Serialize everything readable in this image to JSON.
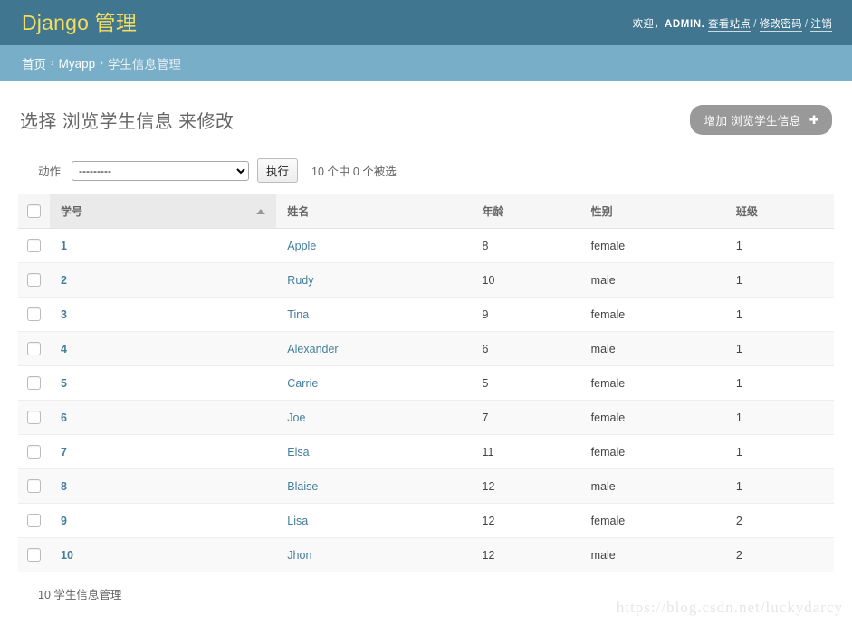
{
  "header": {
    "site_title": "Django 管理",
    "welcome_prefix": "欢迎，",
    "username": "ADMIN.",
    "links": [
      {
        "label": "查看站点"
      },
      {
        "label": "修改密码"
      },
      {
        "label": "注销"
      }
    ],
    "separator": "/"
  },
  "breadcrumbs": {
    "items": [
      {
        "label": "首页"
      },
      {
        "label": "Myapp"
      },
      {
        "label": "学生信息管理"
      }
    ],
    "separator": "›"
  },
  "main": {
    "page_title": "选择 浏览学生信息 来修改",
    "add_button_label": "增加 浏览学生信息",
    "add_button_icon": "plus-icon",
    "plus_glyph": "✚"
  },
  "actions": {
    "label": "动作",
    "selected_option": "---------",
    "options": [
      "---------"
    ],
    "go_label": "执行",
    "counter": "10 个中 0 个被选"
  },
  "table": {
    "columns": [
      {
        "key": "id",
        "label": "学号",
        "sorted": true,
        "sort_direction": "asc"
      },
      {
        "key": "name",
        "label": "姓名",
        "sorted": false
      },
      {
        "key": "age",
        "label": "年龄",
        "sorted": false
      },
      {
        "key": "gender",
        "label": "性别",
        "sorted": false
      },
      {
        "key": "grade",
        "label": "班级",
        "sorted": false
      }
    ],
    "rows": [
      {
        "id": "1",
        "name": "Apple",
        "age": "8",
        "gender": "female",
        "grade": "1"
      },
      {
        "id": "2",
        "name": "Rudy",
        "age": "10",
        "gender": "male",
        "grade": "1"
      },
      {
        "id": "3",
        "name": "Tina",
        "age": "9",
        "gender": "female",
        "grade": "1"
      },
      {
        "id": "4",
        "name": "Alexander",
        "age": "6",
        "gender": "male",
        "grade": "1"
      },
      {
        "id": "5",
        "name": "Carrie",
        "age": "5",
        "gender": "female",
        "grade": "1"
      },
      {
        "id": "6",
        "name": "Joe",
        "age": "7",
        "gender": "female",
        "grade": "1"
      },
      {
        "id": "7",
        "name": "Elsa",
        "age": "11",
        "gender": "female",
        "grade": "1"
      },
      {
        "id": "8",
        "name": "Blaise",
        "age": "12",
        "gender": "male",
        "grade": "1"
      },
      {
        "id": "9",
        "name": "Lisa",
        "age": "12",
        "gender": "female",
        "grade": "2"
      },
      {
        "id": "10",
        "name": "Jhon",
        "age": "12",
        "gender": "male",
        "grade": "2"
      }
    ]
  },
  "pagination": {
    "summary": "10 学生信息管理"
  },
  "watermark": {
    "text": "https://blog.csdn.net/luckydarcy"
  },
  "colors": {
    "header_bg": "#417690",
    "breadcrumb_bg": "#79aec8",
    "brand": "#f5dd5d",
    "link": "#447e9b",
    "add_button_bg": "#999999"
  }
}
